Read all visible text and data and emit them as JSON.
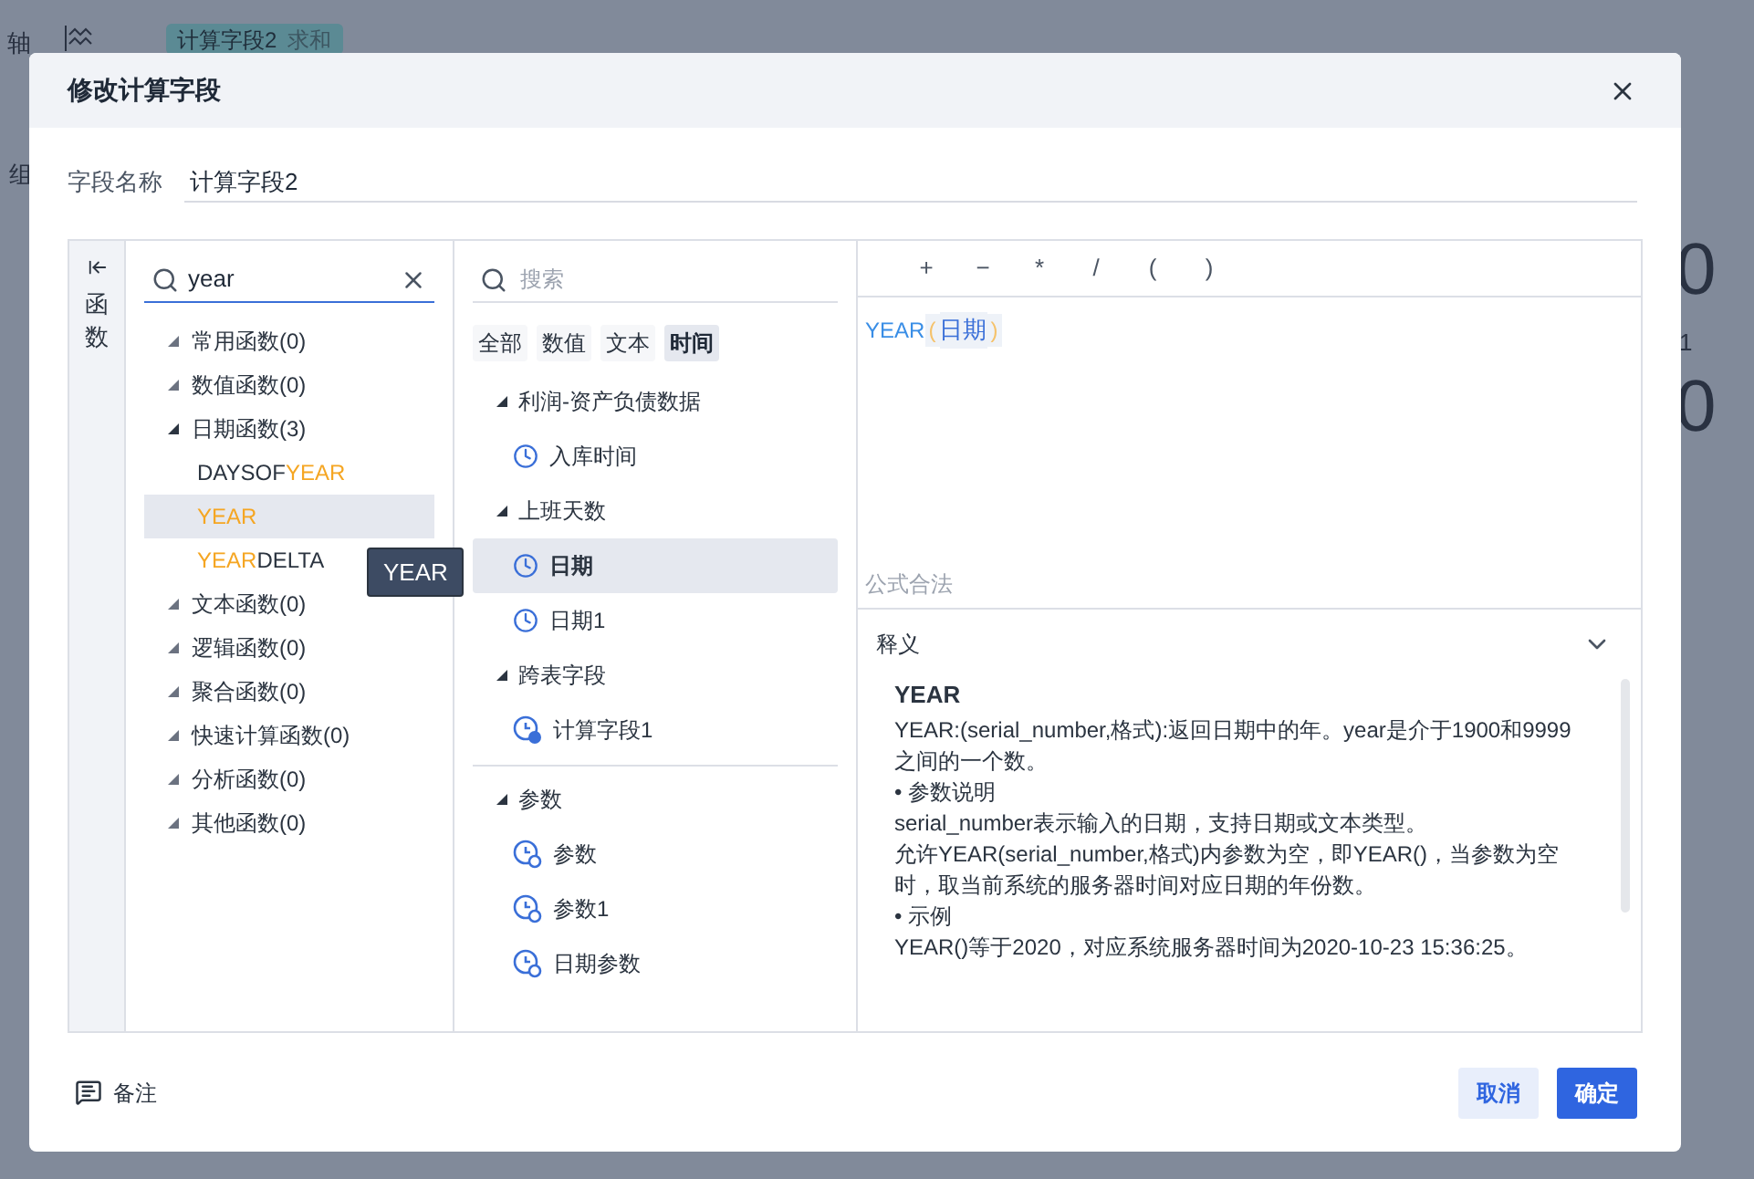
{
  "background": {
    "axis_label": "轴",
    "group_label": "组",
    "chip": {
      "field": "计算字段2",
      "aggregation": "求和"
    },
    "values": [
      "0",
      "1",
      "0"
    ]
  },
  "dialog": {
    "title": "修改计算字段",
    "field_name": {
      "label": "字段名称",
      "value": "计算字段2"
    },
    "side_tab": {
      "label": "函数"
    },
    "function_search": {
      "value": "year"
    },
    "function_groups": [
      {
        "label": "常用函数(0)",
        "expanded": false
      },
      {
        "label": "数值函数(0)",
        "expanded": false
      },
      {
        "label": "日期函数(3)",
        "expanded": true,
        "children": [
          {
            "selected": false,
            "parts": [
              {
                "text": "DAYSOF",
                "match": false
              },
              {
                "text": "YEAR",
                "match": true
              }
            ]
          },
          {
            "selected": true,
            "parts": [
              {
                "text": "YEAR",
                "match": true
              }
            ]
          },
          {
            "selected": false,
            "parts": [
              {
                "text": "YEAR",
                "match": true
              },
              {
                "text": "DELTA",
                "match": false
              }
            ]
          }
        ]
      },
      {
        "label": "文本函数(0)",
        "expanded": false
      },
      {
        "label": "逻辑函数(0)",
        "expanded": false
      },
      {
        "label": "聚合函数(0)",
        "expanded": false
      },
      {
        "label": "快速计算函数(0)",
        "expanded": false
      },
      {
        "label": "分析函数(0)",
        "expanded": false
      },
      {
        "label": "其他函数(0)",
        "expanded": false
      }
    ],
    "tooltip": "YEAR",
    "field_search": {
      "placeholder": "搜索"
    },
    "filters": [
      {
        "label": "全部",
        "selected": false
      },
      {
        "label": "数值",
        "selected": false
      },
      {
        "label": "文本",
        "selected": false
      },
      {
        "label": "时间",
        "selected": true
      }
    ],
    "field_groups": [
      {
        "label": "利润-资产负债数据",
        "divider_before": false,
        "children": [
          {
            "label": "入库时间",
            "kind": "time",
            "selected": false
          }
        ]
      },
      {
        "label": "上班天数",
        "divider_before": false,
        "children": [
          {
            "label": "日期",
            "kind": "time",
            "selected": true
          },
          {
            "label": "日期1",
            "kind": "time",
            "selected": false
          }
        ]
      },
      {
        "label": "跨表字段",
        "divider_before": false,
        "children": [
          {
            "label": "计算字段1",
            "kind": "calc",
            "selected": false
          }
        ]
      },
      {
        "label": "参数",
        "divider_before": true,
        "children": [
          {
            "label": "参数",
            "kind": "param",
            "selected": false
          },
          {
            "label": "参数1",
            "kind": "param",
            "selected": false
          },
          {
            "label": "日期参数",
            "kind": "param",
            "selected": false
          }
        ]
      }
    ],
    "operators": [
      "+",
      "−",
      "*",
      "/",
      "(",
      ")"
    ],
    "formula": [
      {
        "text": "YEAR",
        "kind": "func"
      },
      {
        "text": "(",
        "kind": "paren"
      },
      {
        "text": "日期",
        "kind": "field"
      },
      {
        "text": ")",
        "kind": "paren"
      }
    ],
    "formula_status": "公式合法",
    "definition": {
      "title": "释义",
      "expanded": true,
      "heading": "YEAR",
      "lines": [
        "YEAR:(serial_number,格式):返回日期中的年。year是介于1900和9999之间的一个数。",
        "•  参数说明",
        "serial_number表示输入的日期，支持日期或文本类型。",
        "允许YEAR(serial_number,格式)内参数为空，即YEAR()，当参数为空时，取当前系统的服务器时间对应日期的年份数。",
        "•  示例",
        "YEAR()等于2020，对应系统服务器时间为2020-10-23 15:36:25。"
      ]
    },
    "note": "备注",
    "buttons": [
      {
        "label": "取消",
        "kind": "secondary"
      },
      {
        "label": "确定",
        "kind": "primary"
      }
    ]
  }
}
